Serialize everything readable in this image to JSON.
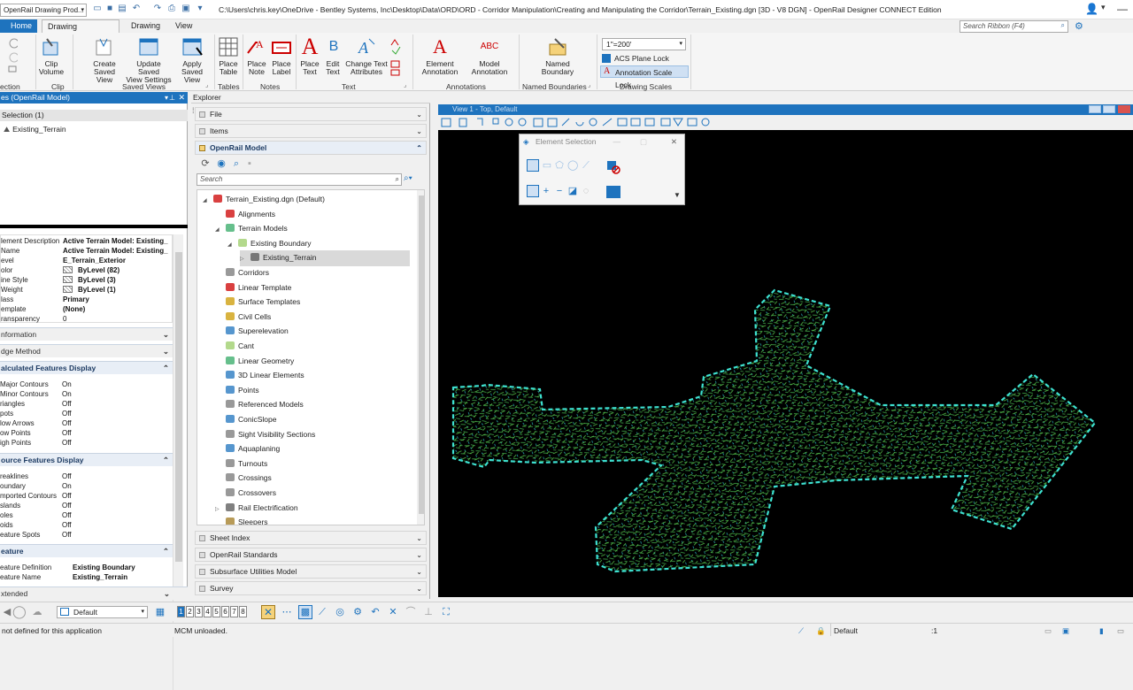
{
  "titlebar": {
    "workspace": "OpenRail Drawing Prod...",
    "title": "C:\\Users\\chris.key\\OneDrive - Bentley Systems, Inc\\Desktop\\Data\\ORD\\ORD - Corridor Manipulation\\Creating and Manipulating the Corridor\\Terrain_Existing.dgn [3D - V8 DGN] - OpenRail Designer CONNECT Edition",
    "search_placeholder": "Search Ribbon (F4)"
  },
  "tabs": [
    "Home",
    "Drawing Production",
    "Drawing",
    "View"
  ],
  "ribbon": {
    "buttons": {
      "clip_volume": "Clip\nVolume",
      "create_saved_view": "Create\nSaved View",
      "update_saved_view": "Update Saved\nView Settings",
      "apply_saved_view": "Apply\nSaved View",
      "place_table": "Place\nTable",
      "place_note": "Place\nNote",
      "place_label": "Place\nLabel",
      "place_text": "Place\nText",
      "edit_text": "Edit\nText",
      "change_text_attributes": "Change Text\nAttributes",
      "element_annotation": "Element\nAnnotation",
      "model_annotation": "Model\nAnnotation",
      "named_boundary": "Named\nBoundary"
    },
    "groups": {
      "selection": "ection",
      "clip": "Clip",
      "saved_views": "Saved Views",
      "tables": "Tables",
      "notes": "Notes",
      "text": "Text",
      "annotations": "Annotations",
      "named_boundaries": "Named Boundaries",
      "drawing_scales": "Drawing Scales"
    },
    "scale_value": "1\"=200'",
    "acs_plane_lock": "ACS Plane Lock",
    "annotation_scale_lock": "Annotation Scale Lock",
    "edit_text_icon_letter": "B",
    "place_text_icon_letter": "A",
    "model_annotation_icon_text": "ABC"
  },
  "properties": {
    "header": "es (OpenRail Model)",
    "selection_label": "Selection (1)",
    "selected_item": "Existing_Terrain",
    "general": [
      {
        "k": "lement Description",
        "v": "Active Terrain Model: Existing_"
      },
      {
        "k": "Name",
        "v": "Active Terrain Model: Existing_"
      },
      {
        "k": "evel",
        "v": "E_Terrain_Exterior"
      },
      {
        "k": "olor",
        "v": "ByLevel (82)"
      },
      {
        "k": "ine Style",
        "v": "ByLevel (3)"
      },
      {
        "k": "Weight",
        "v": "ByLevel (1)"
      },
      {
        "k": "lass",
        "v": "Primary"
      },
      {
        "k": "emplate",
        "v": "(None)"
      },
      {
        "k": "ransparency",
        "v": "0"
      }
    ],
    "section_information": "nformation",
    "section_edge_method": "dge Method",
    "section_calculated": "alculated Features Display",
    "calculated": [
      {
        "k": "Major Contours",
        "v": "On"
      },
      {
        "k": "Minor Contours",
        "v": "On"
      },
      {
        "k": "riangles",
        "v": "Off"
      },
      {
        "k": "pots",
        "v": "Off"
      },
      {
        "k": "low Arrows",
        "v": "Off"
      },
      {
        "k": "ow Points",
        "v": "Off"
      },
      {
        "k": "igh Points",
        "v": "Off"
      }
    ],
    "section_source": "ource Features Display",
    "source": [
      {
        "k": "reaklines",
        "v": "Off"
      },
      {
        "k": "oundary",
        "v": "On"
      },
      {
        "k": "mported Contours",
        "v": "Off"
      },
      {
        "k": "slands",
        "v": "Off"
      },
      {
        "k": "oles",
        "v": "Off"
      },
      {
        "k": "oids",
        "v": "Off"
      },
      {
        "k": "eature Spots",
        "v": "Off"
      }
    ],
    "section_feature": "eature",
    "feature": [
      {
        "k": "eature Definition",
        "v": "Existing Boundary"
      },
      {
        "k": "eature Name",
        "v": "Existing_Terrain"
      }
    ],
    "section_extended": "xtended"
  },
  "explorer": {
    "header": "Explorer",
    "bars_top": [
      "File",
      "Items"
    ],
    "model_bar": "OpenRail Model",
    "search_placeholder": "Search",
    "tree": [
      {
        "label": "Terrain_Existing.dgn (Default)",
        "indent": 0,
        "icon": "dgn-icon",
        "exp": "◢"
      },
      {
        "label": "Alignments",
        "indent": 1,
        "icon": "alignment-icon",
        "exp": ""
      },
      {
        "label": "Terrain Models",
        "indent": 1,
        "icon": "terrain-icon",
        "exp": "◢"
      },
      {
        "label": "Existing Boundary",
        "indent": 2,
        "icon": "boundary-icon",
        "exp": "◢"
      },
      {
        "label": "Existing_Terrain",
        "indent": 3,
        "icon": "terrain-model-icon",
        "exp": "▷",
        "selected": true
      },
      {
        "label": "Corridors",
        "indent": 1,
        "icon": "corridor-icon",
        "exp": ""
      },
      {
        "label": "Linear Template",
        "indent": 1,
        "icon": "linear-template-icon",
        "exp": ""
      },
      {
        "label": "Surface Templates",
        "indent": 1,
        "icon": "surface-template-icon",
        "exp": ""
      },
      {
        "label": "Civil Cells",
        "indent": 1,
        "icon": "civil-cell-icon",
        "exp": ""
      },
      {
        "label": "Superelevation",
        "indent": 1,
        "icon": "superelevation-icon",
        "exp": ""
      },
      {
        "label": "Cant",
        "indent": 1,
        "icon": "cant-icon",
        "exp": ""
      },
      {
        "label": "Linear Geometry",
        "indent": 1,
        "icon": "linear-geometry-icon",
        "exp": ""
      },
      {
        "label": "3D Linear Elements",
        "indent": 1,
        "icon": "3d-linear-icon",
        "exp": ""
      },
      {
        "label": "Points",
        "indent": 1,
        "icon": "points-icon",
        "exp": ""
      },
      {
        "label": "Referenced Models",
        "indent": 1,
        "icon": "referenced-models-icon",
        "exp": ""
      },
      {
        "label": "ConicSlope",
        "indent": 1,
        "icon": "conicslope-icon",
        "exp": ""
      },
      {
        "label": "Sight Visibility Sections",
        "indent": 1,
        "icon": "sight-visibility-icon",
        "exp": ""
      },
      {
        "label": "Aquaplaning",
        "indent": 1,
        "icon": "aquaplaning-icon",
        "exp": ""
      },
      {
        "label": "Turnouts",
        "indent": 1,
        "icon": "turnouts-icon",
        "exp": ""
      },
      {
        "label": "Crossings",
        "indent": 1,
        "icon": "crossings-icon",
        "exp": ""
      },
      {
        "label": "Crossovers",
        "indent": 1,
        "icon": "crossovers-icon",
        "exp": ""
      },
      {
        "label": "Rail Electrification",
        "indent": 1,
        "icon": "rail-electrification-icon",
        "exp": "▷"
      },
      {
        "label": "Sleepers",
        "indent": 1,
        "icon": "sleepers-icon",
        "exp": ""
      }
    ],
    "bars_bottom": [
      "Sheet Index",
      "OpenRail Standards",
      "Subsurface Utilities Model",
      "Survey"
    ]
  },
  "viewport": {
    "title": "View 1 - Top, Default",
    "background": "#000000",
    "boundary_color": "#3de0d0",
    "contour_color": "#3fa84a"
  },
  "element_selection": {
    "title": "Element Selection"
  },
  "bottombar": {
    "level_value": "Default",
    "view_numbers": [
      "1",
      "2",
      "3",
      "4",
      "5",
      "6",
      "7",
      "8"
    ],
    "active_view": "1"
  },
  "status": {
    "left": "not defined for this application",
    "middle": "MCM unloaded.",
    "level": "Default",
    "scale": ":1"
  }
}
